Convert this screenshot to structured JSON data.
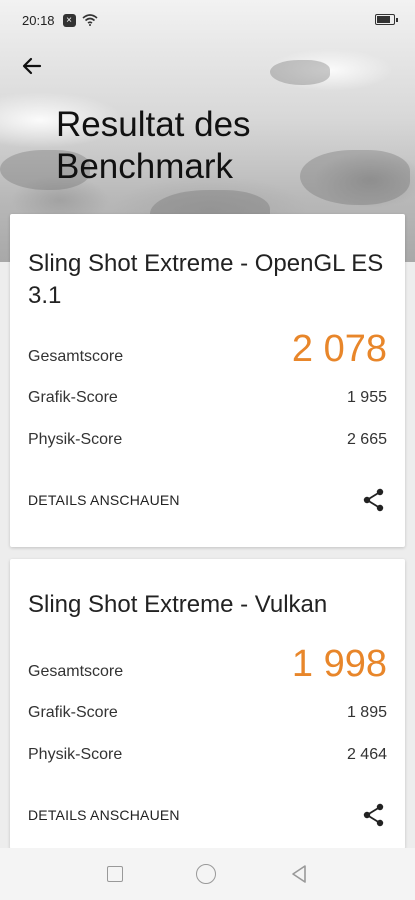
{
  "status_bar": {
    "time": "20:18"
  },
  "page": {
    "title": "Resultat des Benchmark"
  },
  "results": [
    {
      "test_name": "Sling Shot Extreme - OpenGL ES 3.1",
      "total_label": "Gesamtscore",
      "total_value": "2 078",
      "graphics_label": "Grafik-Score",
      "graphics_value": "1 955",
      "physics_label": "Physik-Score",
      "physics_value": "2 665",
      "details_label": "DETAILS ANSCHAUEN"
    },
    {
      "test_name": "Sling Shot Extreme - Vulkan",
      "total_label": "Gesamtscore",
      "total_value": "1 998",
      "graphics_label": "Grafik-Score",
      "graphics_value": "1 895",
      "physics_label": "Physik-Score",
      "physics_value": "2 464",
      "details_label": "DETAILS ANSCHAUEN"
    }
  ],
  "colors": {
    "accent": "#e8862a",
    "card_bg": "#ffffff"
  },
  "icons": [
    "back-arrow-icon",
    "share-icon",
    "nav-recents-icon",
    "nav-home-icon",
    "nav-back-icon"
  ]
}
